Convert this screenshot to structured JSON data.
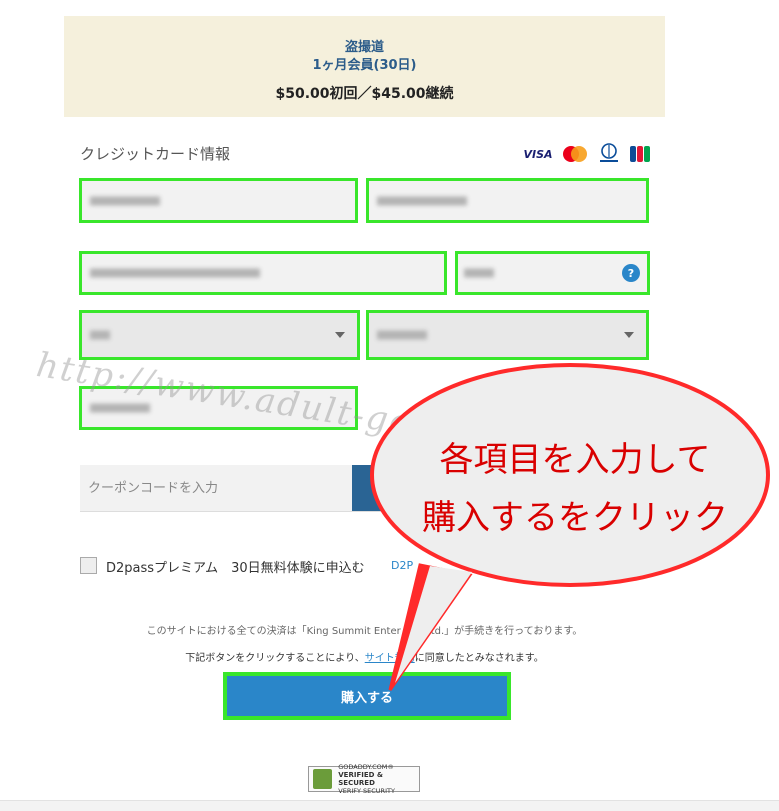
{
  "plan": {
    "name": "盗撮道",
    "term": "1ヶ月会員(30日)",
    "price": "$50.00初回／$45.00継続"
  },
  "credit_card": {
    "title": "クレジットカード情報",
    "card_icons": [
      "visa-icon",
      "mastercard-icon",
      "diners-club-icon",
      "jcb-icon"
    ],
    "visa_label": "VISA",
    "help_label": "?"
  },
  "coupon": {
    "placeholder": "クーポンコードを入力"
  },
  "premium": {
    "label": "D2passプレミアム　30日無料体験に申込む",
    "link": "D2P"
  },
  "disclaimer": {
    "line1": "このサイトにおける全ての決済は「King Summit Enter",
    "line1_end": "td.」が手続きを行っております。",
    "line2_before": "下記ボタンをクリックすることにより、",
    "terms_link": "サイト規約",
    "line2_after": "に同意したとみなされます。"
  },
  "purchase_button": {
    "label": "購入する"
  },
  "badge": {
    "line1": "GODADDY.COM®",
    "line2": "VERIFIED & SECURED",
    "line3": "VERIFY SECURITY"
  },
  "watermark": "http://www.adult-goodnavi.net/",
  "callout": {
    "line1": "各項目を入力して",
    "line2": "購入するをクリック"
  },
  "colors": {
    "highlight": "#39e62b",
    "button_blue": "#2a86c9",
    "plan_bg": "#f5f0dc",
    "callout_red": "#d90000"
  }
}
